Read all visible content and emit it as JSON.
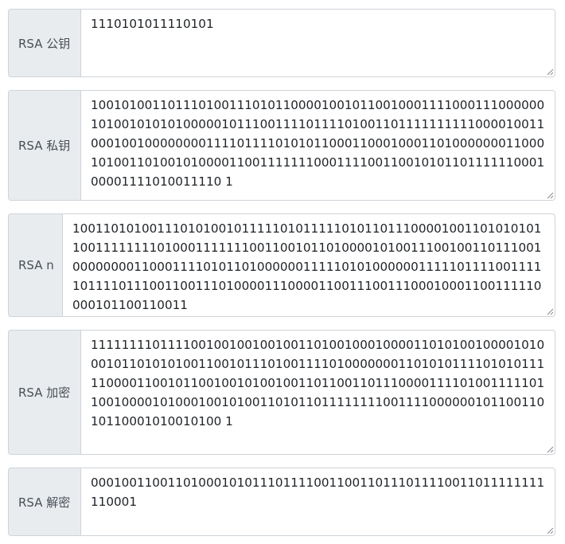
{
  "fields": [
    {
      "label": "RSA 公钥",
      "value": "1110101011110101"
    },
    {
      "label": "RSA 私钥",
      "value": "1001010011011101001110101100001001011001000111100011100000010100101010100000101110011110111101001101111111111000010011000100100000000111101111010101100011000100011010000000110001010011010010100001100111111100011110011001010110111111000100001111010011110 1"
    },
    {
      "label": "RSA n",
      "value": "1001101010011101010010111110101111101011011100001001101010101100111111110100011111110011001011010000101001110010011011100100000000110001111010110100000011111010100000011111011110011111011110111001100111010000111000011001110011100010001100111110000101100110011"
    },
    {
      "label": "RSA 加密",
      "value": "1111111101111001001001001001101001000100001101010010000101000101101010100110010111010011110100000001101010111101010111110000110010110010010100100110110011011100001111010011111011001000010100010010100110101101111111100111100000010110011010110001010010100 1"
    },
    {
      "label": "RSA 解密",
      "value": "00010011001101000101011101111001100110111011110011011111111110001"
    }
  ]
}
